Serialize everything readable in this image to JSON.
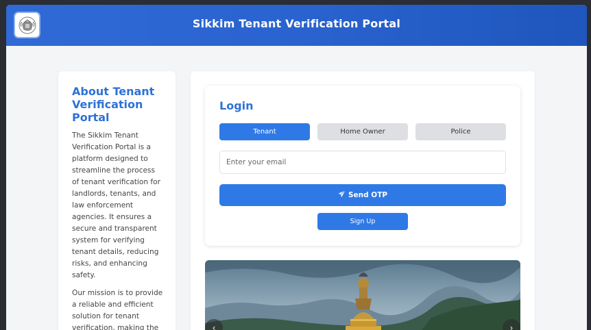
{
  "header": {
    "title": "Sikkim Tenant Verification Portal",
    "logo_icon": "state-emblem-icon"
  },
  "about": {
    "heading": "About Tenant Verification Portal",
    "paragraph1": "The Sikkim Tenant Verification Portal is a platform designed to streamline the process of tenant verification for landlords, tenants, and law enforcement agencies. It ensures a secure and transparent system for verifying tenant details, reducing risks, and enhancing safety.",
    "paragraph2": "Our mission is to provide a reliable and efficient solution for tenant verification, making the"
  },
  "login": {
    "title": "Login",
    "tabs": [
      {
        "label": "Tenant",
        "active": true
      },
      {
        "label": "Home Owner",
        "active": false
      },
      {
        "label": "Police",
        "active": false
      }
    ],
    "email_placeholder": "Enter your email",
    "send_otp_label": "Send OTP",
    "send_icon": "paper-plane-icon",
    "signup_label": "Sign Up"
  },
  "carousel": {
    "prev_icon": "chevron-left-icon",
    "next_icon": "chevron-right-icon"
  },
  "colors": {
    "header_blue": "#2a63cf",
    "accent_blue": "#2f79e6",
    "heading_blue": "#2d72d6"
  }
}
